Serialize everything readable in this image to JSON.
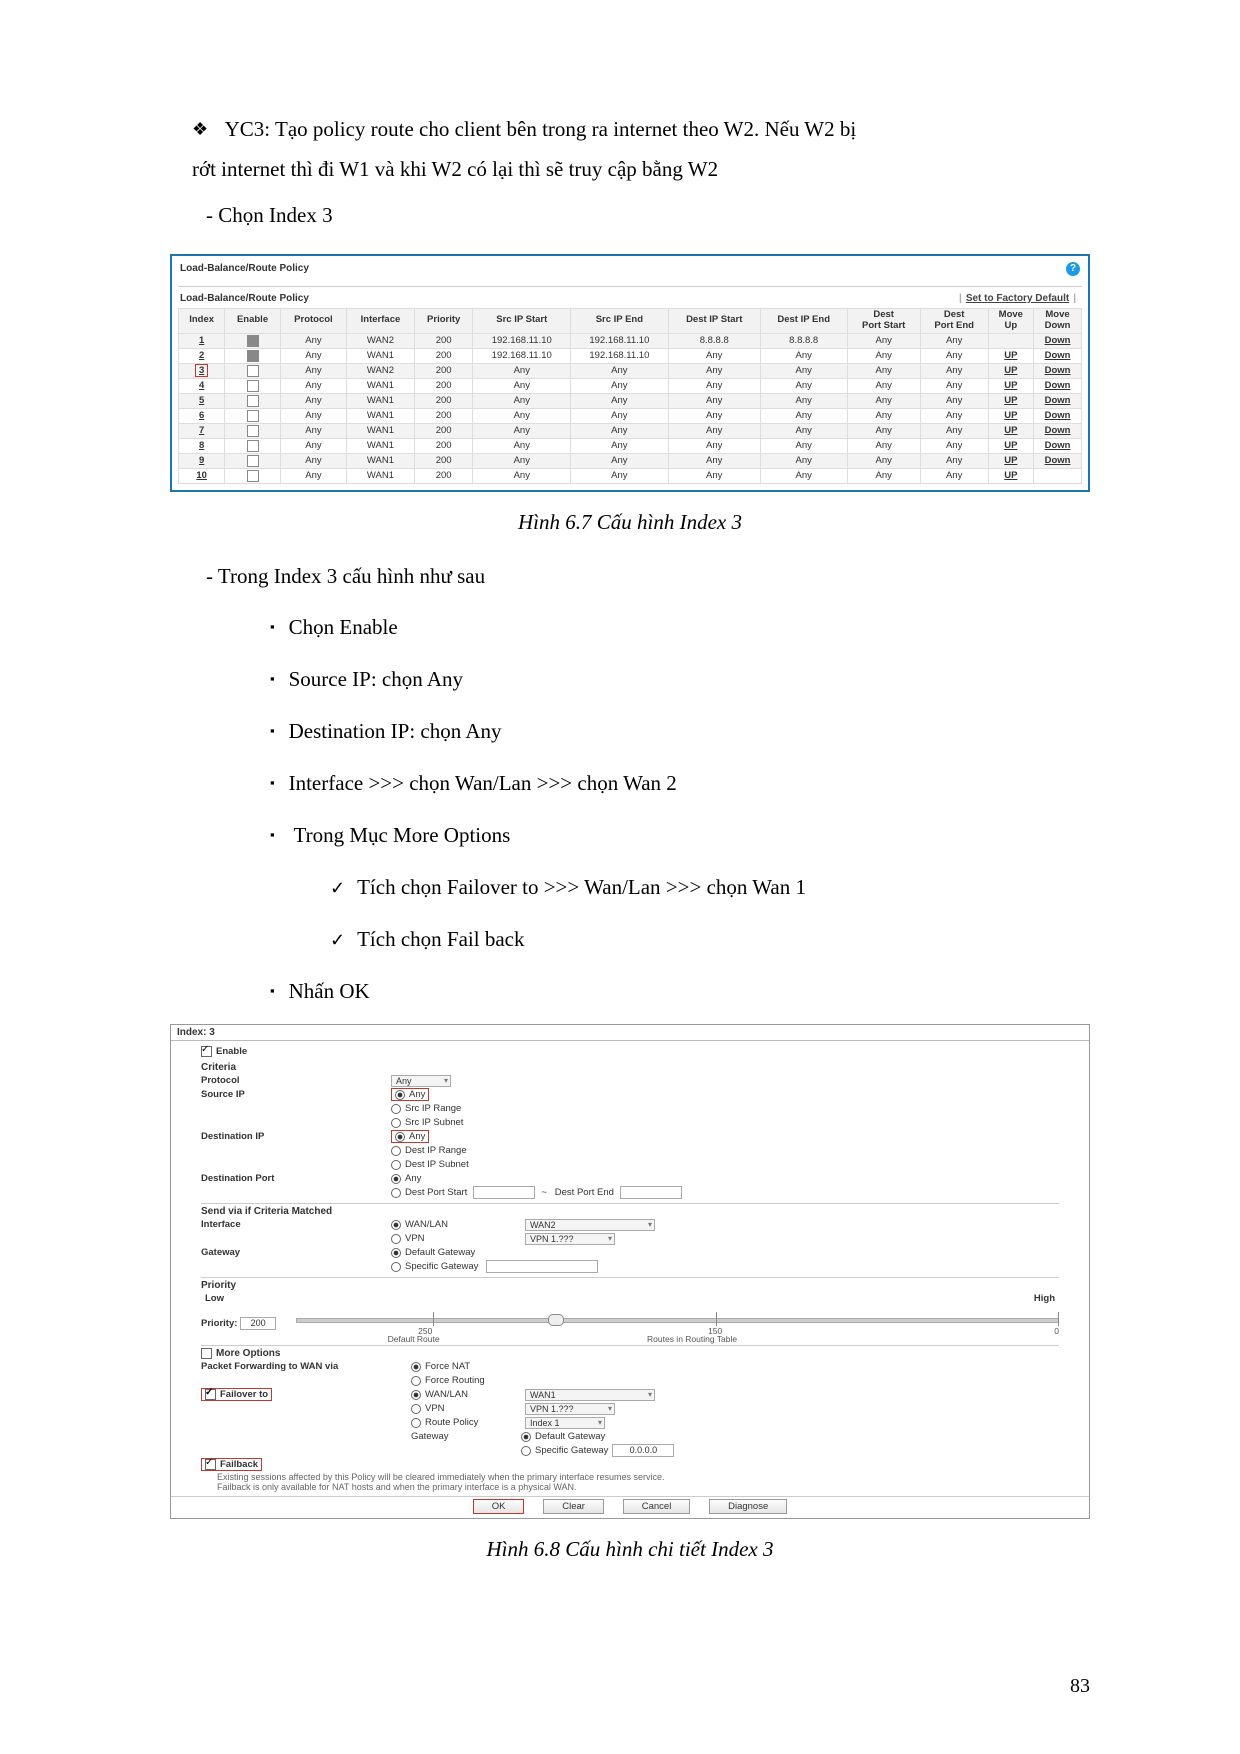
{
  "pageNumber": "83",
  "para1a": "YC3: Tạo policy route cho client bên trong ra internet theo W2. Nếu W2 bị",
  "para1b": "rớt internet thì đi W1 và khi W2 có lại thì sẽ truy cập bằng W2",
  "chooseIndex3": "- Chọn Index 3",
  "caption1": "Hình 6.7 Cấu hình Index 3",
  "inIndex3": "- Trong Index 3 cấu hình như sau",
  "bullets": {
    "b1": "Chọn Enable",
    "b2": "Source IP: chọn Any",
    "b3": "Destination IP: chọn Any",
    "b4": "Interface >>> chọn Wan/Lan >>> chọn Wan 2",
    "b5": "Trong Mục More Options",
    "c1": "Tích chọn Failover to >>> Wan/Lan >>> chọn Wan 1",
    "c2": "Tích chọn Fail back",
    "b6": "Nhấn OK"
  },
  "caption2": "Hình 6.8 Cấu hình chi tiết Index 3",
  "shot1": {
    "title": "Load-Balance/Route Policy",
    "subTitle": "Load-Balance/Route Policy",
    "factoryDefault": "Set to Factory Default",
    "headers": [
      "Index",
      "Enable",
      "Protocol",
      "Interface",
      "Priority",
      "Src IP Start",
      "Src IP End",
      "Dest IP Start",
      "Dest IP End",
      "Dest Port Start",
      "Dest Port End",
      "Move Up",
      "Move Down"
    ],
    "rows": [
      {
        "n": "1",
        "en": true,
        "p": "Any",
        "if": "WAN2",
        "pr": "200",
        "s1": "192.168.11.10",
        "s2": "192.168.11.10",
        "d1": "8.8.8.8",
        "d2": "8.8.8.8",
        "dp1": "Any",
        "dp2": "Any",
        "up": "",
        "dn": "Down"
      },
      {
        "n": "2",
        "en": true,
        "p": "Any",
        "if": "WAN1",
        "pr": "200",
        "s1": "192.168.11.10",
        "s2": "192.168.11.10",
        "d1": "Any",
        "d2": "Any",
        "dp1": "Any",
        "dp2": "Any",
        "up": "UP",
        "dn": "Down"
      },
      {
        "n": "3",
        "en": false,
        "sel": true,
        "p": "Any",
        "if": "WAN2",
        "pr": "200",
        "s1": "Any",
        "s2": "Any",
        "d1": "Any",
        "d2": "Any",
        "dp1": "Any",
        "dp2": "Any",
        "up": "UP",
        "dn": "Down"
      },
      {
        "n": "4",
        "en": false,
        "p": "Any",
        "if": "WAN1",
        "pr": "200",
        "s1": "Any",
        "s2": "Any",
        "d1": "Any",
        "d2": "Any",
        "dp1": "Any",
        "dp2": "Any",
        "up": "UP",
        "dn": "Down"
      },
      {
        "n": "5",
        "en": false,
        "p": "Any",
        "if": "WAN1",
        "pr": "200",
        "s1": "Any",
        "s2": "Any",
        "d1": "Any",
        "d2": "Any",
        "dp1": "Any",
        "dp2": "Any",
        "up": "UP",
        "dn": "Down"
      },
      {
        "n": "6",
        "en": false,
        "p": "Any",
        "if": "WAN1",
        "pr": "200",
        "s1": "Any",
        "s2": "Any",
        "d1": "Any",
        "d2": "Any",
        "dp1": "Any",
        "dp2": "Any",
        "up": "UP",
        "dn": "Down"
      },
      {
        "n": "7",
        "en": false,
        "p": "Any",
        "if": "WAN1",
        "pr": "200",
        "s1": "Any",
        "s2": "Any",
        "d1": "Any",
        "d2": "Any",
        "dp1": "Any",
        "dp2": "Any",
        "up": "UP",
        "dn": "Down"
      },
      {
        "n": "8",
        "en": false,
        "p": "Any",
        "if": "WAN1",
        "pr": "200",
        "s1": "Any",
        "s2": "Any",
        "d1": "Any",
        "d2": "Any",
        "dp1": "Any",
        "dp2": "Any",
        "up": "UP",
        "dn": "Down"
      },
      {
        "n": "9",
        "en": false,
        "p": "Any",
        "if": "WAN1",
        "pr": "200",
        "s1": "Any",
        "s2": "Any",
        "d1": "Any",
        "d2": "Any",
        "dp1": "Any",
        "dp2": "Any",
        "up": "UP",
        "dn": "Down"
      },
      {
        "n": "10",
        "en": false,
        "p": "Any",
        "if": "WAN1",
        "pr": "200",
        "s1": "Any",
        "s2": "Any",
        "d1": "Any",
        "d2": "Any",
        "dp1": "Any",
        "dp2": "Any",
        "up": "UP",
        "dn": ""
      }
    ]
  },
  "shot2": {
    "indexHdr": "Index: 3",
    "enable": "Enable",
    "criteria": "Criteria",
    "protocol": "Protocol",
    "protocolVal": "Any",
    "sourceIP": "Source IP",
    "any": "Any",
    "srcIpRange": "Src IP Range",
    "srcIpSubnet": "Src IP Subnet",
    "destIP": "Destination IP",
    "destIpRange": "Dest IP Range",
    "destIpSubnet": "Dest IP Subnet",
    "destPort": "Destination Port",
    "destPortStart": "Dest Port Start",
    "destPortEnd": "Dest Port End",
    "sendVia": "Send via if Criteria Matched",
    "interface": "Interface",
    "wanlan": "WAN/LAN",
    "wan2": "WAN2",
    "vpn": "VPN",
    "vpnVal": "VPN 1.???",
    "gateway": "Gateway",
    "defaultGw": "Default Gateway",
    "specificGw": "Specific Gateway",
    "priority": "Priority",
    "low": "Low",
    "high": "High",
    "priorityLabel": "Priority:",
    "priorityVal": "200",
    "tick250": "250",
    "tickDefault": "Default Route",
    "tick150": "150",
    "tickRoutes": "Routes in Routing Table",
    "tick0": "0",
    "moreOptions": "More Options",
    "pktFwd": "Packet Forwarding to WAN via",
    "forceNat": "Force NAT",
    "forceRouting": "Force Routing",
    "failoverTo": "Failover to",
    "wan1": "WAN1",
    "routePolicy": "Route Policy",
    "index1": "Index 1",
    "specificGwVal": "0.0.0.0",
    "failback": "Failback",
    "note1": "Existing sessions affected by this Policy will be cleared immediately when the primary interface resumes service.",
    "note2": "Failback is only available for NAT hosts and when the primary interface is a physical WAN.",
    "btnOK": "OK",
    "btnClear": "Clear",
    "btnCancel": "Cancel",
    "btnDiagnose": "Diagnose"
  }
}
